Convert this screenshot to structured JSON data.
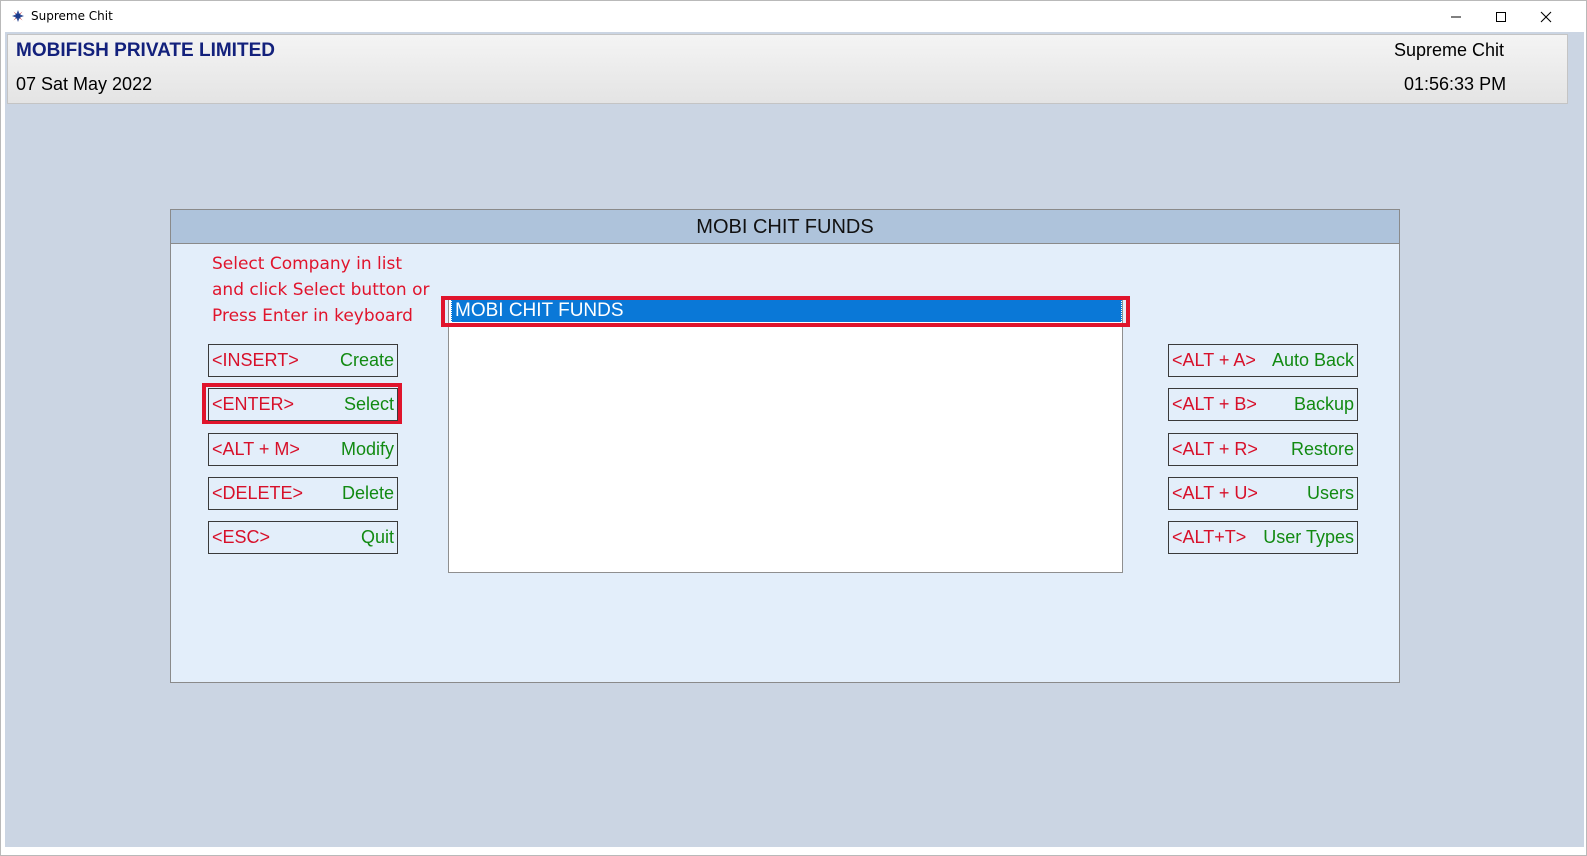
{
  "window": {
    "title": "Supreme Chit"
  },
  "header": {
    "company_name": "MOBIFISH PRIVATE LIMITED",
    "date": "07 Sat May 2022",
    "app_name": "Supreme Chit",
    "time": "01:56:33 PM"
  },
  "panel": {
    "title": "MOBI CHIT FUNDS",
    "instructions": [
      "Select Company in list",
      "and click Select button or",
      "Press Enter in keyboard"
    ],
    "left_buttons": [
      {
        "key": "<INSERT>",
        "action": "Create"
      },
      {
        "key": "<ENTER>",
        "action": "Select"
      },
      {
        "key": "<ALT + M>",
        "action": "Modify"
      },
      {
        "key": "<DELETE>",
        "action": "Delete"
      },
      {
        "key": "<ESC>",
        "action": "Quit"
      }
    ],
    "right_buttons": [
      {
        "key": "<ALT + A>",
        "action": "Auto Back"
      },
      {
        "key": "<ALT + B>",
        "action": "Backup"
      },
      {
        "key": "<ALT + R>",
        "action": "Restore"
      },
      {
        "key": "<ALT + U>",
        "action": "Users"
      },
      {
        "key": "<ALT+T>",
        "action": "User Types"
      }
    ],
    "company_list": [
      "MOBI CHIT FUNDS"
    ],
    "selected_index": 0
  },
  "colors": {
    "highlight": "#e0142c",
    "key_text": "#d7102a",
    "action_text": "#128a12",
    "selection": "#0a78d7",
    "company_name": "#13217c"
  }
}
